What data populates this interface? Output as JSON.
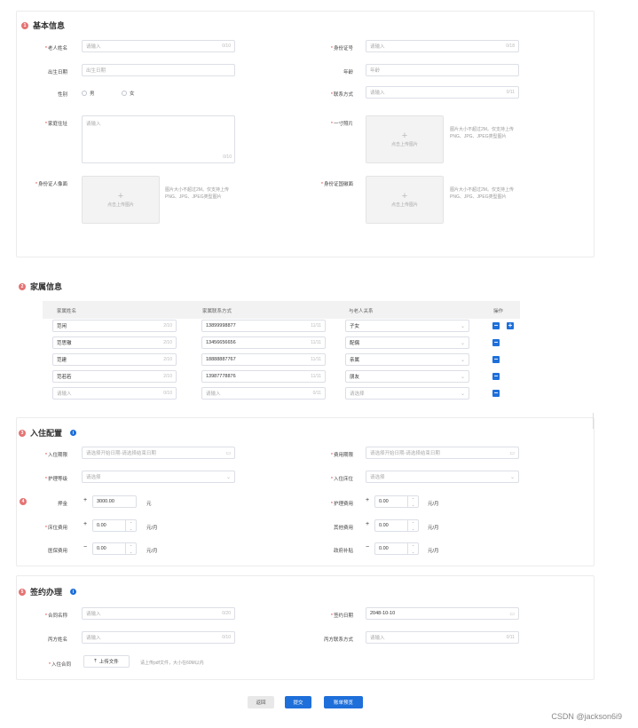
{
  "section1": {
    "number": "1",
    "title": "基本信息",
    "name_label": "老人姓名",
    "name_placeholder": "请输入",
    "name_count": "0/10",
    "id_label": "身份证号",
    "id_placeholder": "请输入",
    "id_count": "0/18",
    "birth_label": "出生日期",
    "birth_placeholder": "出生日期",
    "age_label": "年龄",
    "age_placeholder": "年龄",
    "gender_label": "性别",
    "gender_male": "男",
    "gender_female": "女",
    "contact_label": "联系方式",
    "contact_placeholder": "请输入",
    "contact_count": "0/11",
    "address_label": "家庭住址",
    "address_placeholder": "请输入",
    "address_count": "0/10",
    "photo_label": "一寸照片",
    "upload_text": "点击上传图片",
    "upload_hint": "图片大小不超过2M。仅支持上传PNG、JPG、JPEG类型图片",
    "id_front_label": "身份证人像面",
    "id_back_label": "身份证国徽面"
  },
  "section2": {
    "number": "2",
    "title": "家属信息",
    "headers": [
      "家属姓名",
      "家属联系方式",
      "与老人关系",
      "操作"
    ],
    "rows": [
      {
        "name": "范闲",
        "name_count": "2/10",
        "phone": "13899998877",
        "phone_count": "11/11",
        "relation": "子女"
      },
      {
        "name": "范思辙",
        "name_count": "2/10",
        "phone": "13456656656",
        "phone_count": "11/11",
        "relation": "配偶"
      },
      {
        "name": "范建",
        "name_count": "2/10",
        "phone": "18888887767",
        "phone_count": "11/11",
        "relation": "亲属"
      },
      {
        "name": "范若若",
        "name_count": "2/10",
        "phone": "13987778876",
        "phone_count": "11/11",
        "relation": "朋友"
      },
      {
        "name": "请输入",
        "name_count": "0/10",
        "phone": "请输入",
        "phone_count": "0/11",
        "relation": "请选择"
      }
    ],
    "remove_symbol": "−",
    "add_symbol": "+"
  },
  "section3": {
    "number": "3",
    "title": "入住配置",
    "info": "i",
    "period_label": "入住期限",
    "period_placeholder": "请选择开始日期-请选择结束日期",
    "fee_period_label": "费用期限",
    "fee_period_placeholder": "请选择开始日期-请选择结束日期",
    "care_level_label": "护理等级",
    "care_level_placeholder": "请选择",
    "bed_label": "入住床位",
    "bed_placeholder": "请选择",
    "marker_number": "4",
    "deposit_label": "押金",
    "deposit_value": "3000.00",
    "deposit_unit": "元",
    "care_fee_label": "护理费用",
    "care_fee_value": "0.00",
    "care_fee_unit": "元/月",
    "bed_fee_label": "床位费用",
    "bed_fee_value": "0.00",
    "bed_fee_unit": "元/月",
    "other_fee_label": "其他费用",
    "other_fee_value": "0.00",
    "other_fee_unit": "元/月",
    "insurance_label": "医保费用",
    "insurance_value": "0.00",
    "insurance_unit": "元/月",
    "subsidy_label": "政府补贴",
    "subsidy_value": "0.00",
    "subsidy_unit": "元/月",
    "plus": "+",
    "minus": "−"
  },
  "section4": {
    "number": "5",
    "title": "签约办理",
    "info": "i",
    "contract_name_label": "合同名称",
    "contract_name_placeholder": "请输入",
    "contract_name_count": "0/20",
    "sign_date_label": "签约日期",
    "sign_date_value": "2048-10-10",
    "party_name_label": "丙方姓名",
    "party_name_placeholder": "请输入",
    "party_name_count": "0/10",
    "party_contact_label": "丙方联系方式",
    "party_contact_placeholder": "请输入",
    "party_contact_count": "0/11",
    "contract_label": "入住合同",
    "upload_button": "上传文件",
    "upload_hint": "请上传pdf文件，大小在60M以内"
  },
  "footer": {
    "back": "返回",
    "submit": "提交",
    "preview": "账单预览"
  },
  "watermark": "CSDN @jackson6i9",
  "colors": {
    "accent": "#1e6fd9",
    "badge": "#e57373",
    "required": "#e53935"
  }
}
